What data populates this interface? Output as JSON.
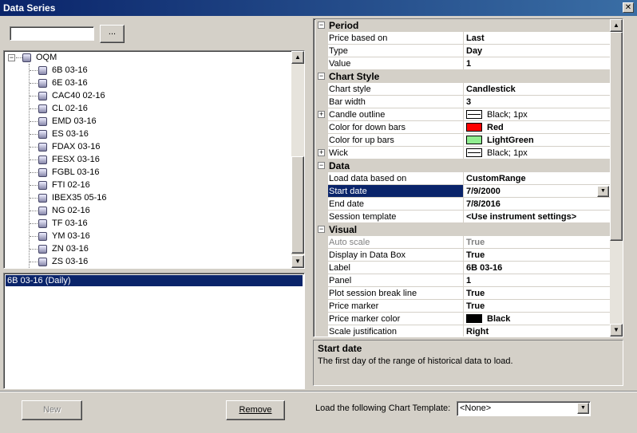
{
  "window": {
    "title": "Data Series",
    "close_glyph": "✕"
  },
  "search": {
    "value": "",
    "placeholder": ""
  },
  "browse_label": "...",
  "tree": {
    "root": "OQM",
    "items": [
      "6B 03-16",
      "6E 03-16",
      "CAC40 02-16",
      "CL 02-16",
      "EMD 03-16",
      "ES 03-16",
      "FDAX 03-16",
      "FESX 03-16",
      "FGBL 03-16",
      "FTI 02-16",
      "IBEX35 05-16",
      "NG 02-16",
      "TF 03-16",
      "YM 03-16",
      "ZN 03-16",
      "ZS 03-16"
    ]
  },
  "selected": {
    "items": [
      "6B 03-16 (Daily)"
    ]
  },
  "properties": {
    "period": {
      "title": "Period",
      "rows": [
        {
          "name": "Price based on",
          "value": "Last"
        },
        {
          "name": "Type",
          "value": "Day"
        },
        {
          "name": "Value",
          "value": "1"
        }
      ]
    },
    "chart_style": {
      "title": "Chart Style",
      "rows": [
        {
          "name": "Chart style",
          "value": "Candlestick"
        },
        {
          "name": "Bar width",
          "value": "3"
        },
        {
          "name": "Candle outline",
          "value": "Black; 1px"
        },
        {
          "name": "Color for down bars",
          "value": "Red",
          "color": "#ff0000"
        },
        {
          "name": "Color for up bars",
          "value": "LightGreen",
          "color": "#90ee90"
        },
        {
          "name": "Wick",
          "value": "Black; 1px"
        }
      ]
    },
    "data": {
      "title": "Data",
      "rows": [
        {
          "name": "Load data based on",
          "value": "CustomRange"
        },
        {
          "name": "Start date",
          "value": "7/9/2000"
        },
        {
          "name": "End date",
          "value": "7/8/2016"
        },
        {
          "name": "Session template",
          "value": "<Use instrument settings>"
        }
      ]
    },
    "visual": {
      "title": "Visual",
      "rows": [
        {
          "name": "Auto scale",
          "value": "True"
        },
        {
          "name": "Display in Data Box",
          "value": "True"
        },
        {
          "name": "Label",
          "value": "6B 03-16"
        },
        {
          "name": "Panel",
          "value": "1"
        },
        {
          "name": "Plot session break line",
          "value": "True"
        },
        {
          "name": "Price marker",
          "value": "True"
        },
        {
          "name": "Price marker color",
          "value": "Black",
          "color": "#000000"
        },
        {
          "name": "Scale justification",
          "value": "Right"
        }
      ]
    }
  },
  "description": {
    "title": "Start date",
    "text": "The first day of the range of historical data to load."
  },
  "buttons": {
    "new": "New",
    "remove": "Remove"
  },
  "template": {
    "label": "Load the following Chart Template:",
    "value": "<None>"
  },
  "colors": {
    "title_bar": "#0a246a",
    "selection": "#0a246a",
    "face": "#d4d0c8"
  }
}
